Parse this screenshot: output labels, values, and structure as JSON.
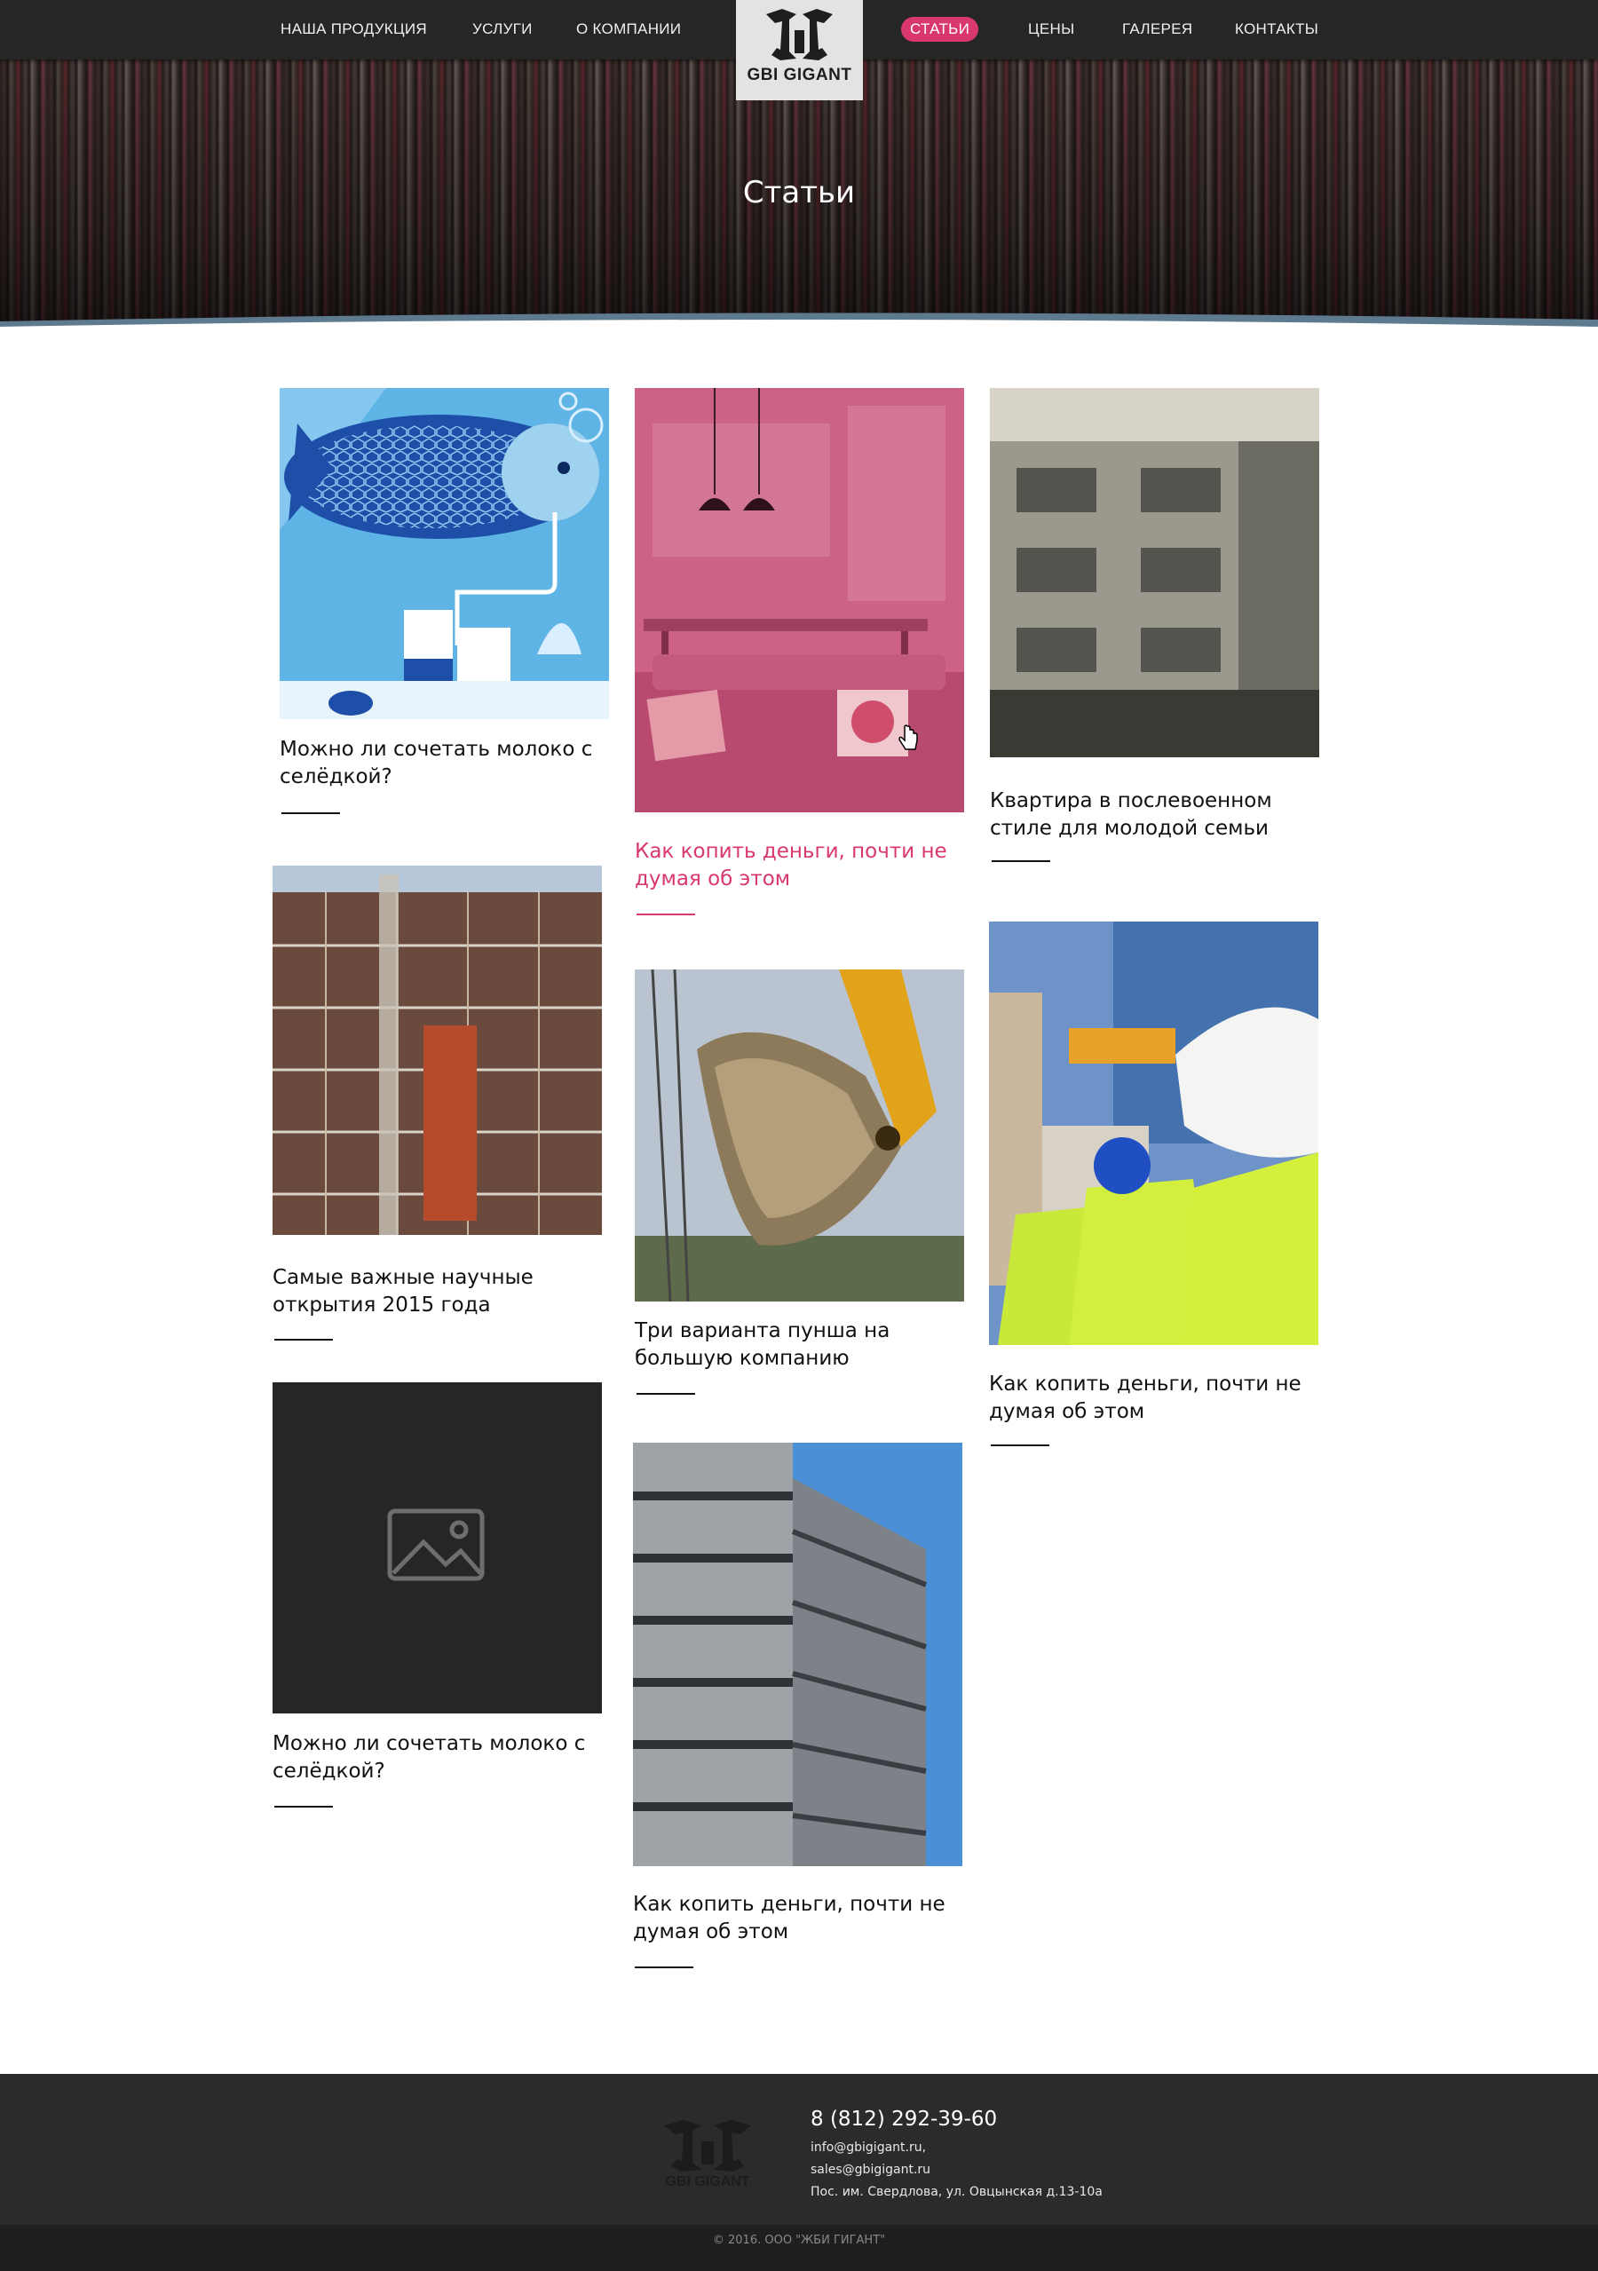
{
  "nav": {
    "items": [
      {
        "label": "НАША ПРОДУКЦИЯ"
      },
      {
        "label": "УСЛУГИ"
      },
      {
        "label": "О КОМПАНИИ"
      },
      {
        "label": "СТАТЬИ"
      },
      {
        "label": "ЦЕНЫ"
      },
      {
        "label": "ГАЛЕРЕЯ"
      },
      {
        "label": "КОНТАКТЫ"
      }
    ],
    "active": "СТАТЬИ",
    "logo_text": "GBI GIGANT"
  },
  "hero": {
    "title": "Статьи"
  },
  "articles": [
    {
      "title": "Можно ли сочетать молоко с селёдкой?",
      "image": "fish-milk-illustration"
    },
    {
      "title": "Как копить деньги, почти не думая об этом",
      "image": "pink-interior",
      "state": "hover"
    },
    {
      "title": "Квартира в послевоенном стиле для молодой семьи",
      "image": "apartment-building"
    },
    {
      "title": "Самые важные научные открытия 2015 года",
      "image": "construction-scaffold"
    },
    {
      "title": "Три варианта пунша на большую компанию",
      "image": "excavator-bucket"
    },
    {
      "title": "Как копить деньги, почти не думая об этом",
      "image": "construction-workers"
    },
    {
      "title": "Можно ли сочетать молоко с селёдкой?",
      "image": "image-placeholder"
    },
    {
      "title": "Как копить деньги, почти не думая об этом",
      "image": "concrete-frame-building"
    }
  ],
  "footer": {
    "phone": "8 (812) 292-39-60",
    "email1": "info@gbigigant.ru,",
    "email2": "sales@gbigigant.ru",
    "address": "Пос. им. Свердлова, ул. Овцынская д.13-10а",
    "copyright": "© 2016. ООО \"ЖБИ ГИГАНТ\"",
    "logo_text": "GBI GIGANT"
  },
  "colors": {
    "accent": "#d9386c",
    "nav_bg": "#262626",
    "footer_bg": "#2b2b2b"
  }
}
